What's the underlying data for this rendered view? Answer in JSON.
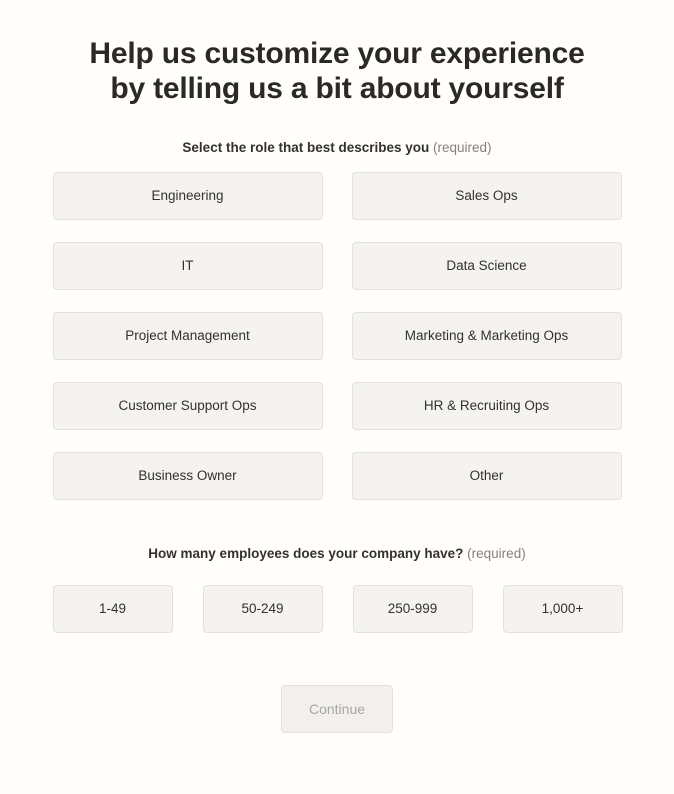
{
  "page": {
    "background_color": "#FFFEFA",
    "heading_line_1": "Help us customize your experience",
    "heading_line_2": "by telling us a bit about yourself"
  },
  "role_question": {
    "label": "Select the role that best describes you",
    "required_note": "(required)",
    "options": [
      {
        "label": "Engineering"
      },
      {
        "label": "Sales Ops"
      },
      {
        "label": "IT"
      },
      {
        "label": "Data Science"
      },
      {
        "label": "Project Management"
      },
      {
        "label": "Marketing & Marketing Ops"
      },
      {
        "label": "Customer Support Ops"
      },
      {
        "label": "HR & Recruiting Ops"
      },
      {
        "label": "Business Owner"
      },
      {
        "label": "Other"
      }
    ]
  },
  "employees_question": {
    "label": "How many employees does your company have?",
    "required_note": "(required)",
    "options": [
      {
        "label": "1-49"
      },
      {
        "label": "50-249"
      },
      {
        "label": "250-999"
      },
      {
        "label": "1,000+"
      }
    ]
  },
  "footer": {
    "continue_label": "Continue"
  },
  "colors": {
    "page_background": "#FFFEFA",
    "choice_fill": "#F4F3F1",
    "choice_border": "#E3E1DE",
    "heading_text": "#2B2926",
    "label_text": "#33312E",
    "muted_text": "#84817D",
    "disabled_text": "#A9A6A2"
  }
}
